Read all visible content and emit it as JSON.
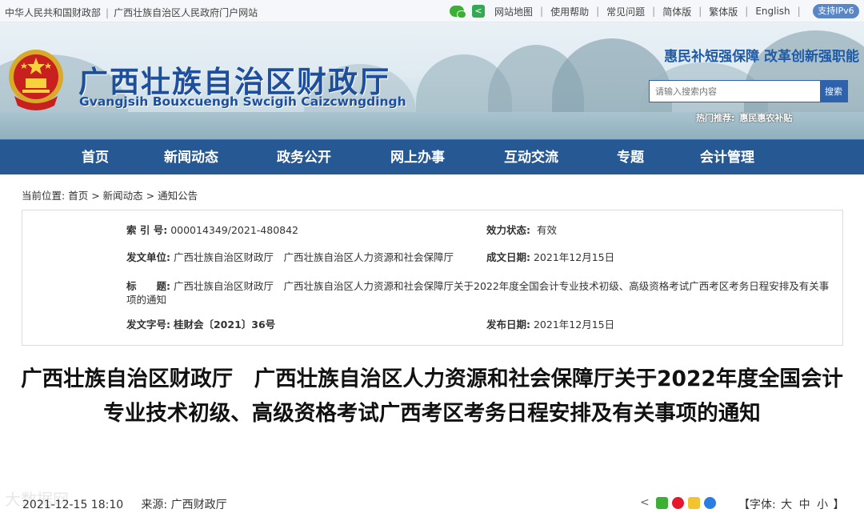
{
  "topbar": {
    "link1": "中华人民共和国财政部",
    "link2": "广西壮族自治区人民政府门户网站",
    "sitemap": "网站地图",
    "help": "使用帮助",
    "faq": "常见问题",
    "simplified": "简体版",
    "traditional": "繁体版",
    "english": "English",
    "ipv6": "支持IPv6"
  },
  "banner": {
    "title": "广西壮族自治区财政厅",
    "subtitle": "Gvangjsih Bouxcuengh Swcigih Caizcwngdingh",
    "slogan": "惠民补短强保障 改革创新强职能",
    "search_placeholder": "请输入搜索内容",
    "search_button": "搜索",
    "hot_label": "热门推荐:",
    "hot_item": "惠民惠农补贴"
  },
  "nav": [
    "首页",
    "新闻动态",
    "政务公开",
    "网上办事",
    "互动交流",
    "专题",
    "会计管理"
  ],
  "breadcrumb": {
    "prefix": "当前位置:",
    "home": "首页",
    "news": "新闻动态",
    "notice": "通知公告",
    "sep": ">"
  },
  "info": {
    "index_label": "索 引 号:",
    "index_value": "000014349/2021-480842",
    "status_label": "效力状态:",
    "status_value": "有效",
    "issuer_label": "发文单位:",
    "issuer_value": "广西壮族自治区财政厅　广西壮族自治区人力资源和社会保障厅",
    "created_label": "成文日期:",
    "created_value": "2021年12月15日",
    "title_label": "标　　题:",
    "title_value": "广西壮族自治区财政厅　广西壮族自治区人力资源和社会保障厅关于2022年度全国会计专业技术初级、高级资格考试广西考区考务日程安排及有关事项的通知",
    "docno_label": "发文字号:",
    "docno_value": "桂财会〔2021〕36号",
    "published_label": "发布日期:",
    "published_value": "2021年12月15日"
  },
  "article": {
    "title": "广西壮族自治区财政厅　广西壮族自治区人力资源和社会保障厅关于2022年度全国会计专业技术初级、高级资格考试广西考区考务日程安排及有关事项的通知",
    "datetime": "2021-12-15 18:10",
    "source_label": "来源:",
    "source_value": "广西财政厅",
    "font_label_open": "【字体:",
    "font_large": "大",
    "font_medium": "中",
    "font_small": "小",
    "font_label_close": "】",
    "watermark": "大数据网"
  },
  "colors": {
    "nav_bg": "#265894",
    "title_blue": "#1e4f9c",
    "ipv6_bg": "#5b86c5"
  }
}
